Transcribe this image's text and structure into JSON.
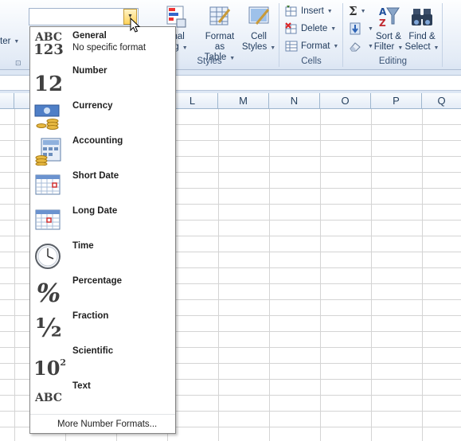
{
  "ribbon": {
    "styles": {
      "conditional_label_1": "onal",
      "conditional_label_2": "ting",
      "format_table_label_1": "Format",
      "format_table_label_2": "as Table",
      "cell_styles_label_1": "Cell",
      "cell_styles_label_2": "Styles",
      "group_label": "Styles"
    },
    "left_partial_label": "ter",
    "cells": {
      "insert": "Insert",
      "delete": "Delete",
      "format": "Format",
      "group_label": "Cells"
    },
    "editing": {
      "sort_label_1": "Sort &",
      "sort_label_2": "Filter",
      "find_label_1": "Find &",
      "find_label_2": "Select",
      "group_label": "Editing"
    }
  },
  "number_format_combo": {
    "value": ""
  },
  "columns": [
    "L",
    "M",
    "N",
    "O",
    "P",
    "Q"
  ],
  "dropdown": {
    "items": [
      {
        "title": "General",
        "subtitle": "No specific format",
        "icon": "abc-123-icon"
      },
      {
        "title": "Number",
        "subtitle": "",
        "icon": "number-12-icon"
      },
      {
        "title": "Currency",
        "subtitle": "",
        "icon": "currency-icon"
      },
      {
        "title": "Accounting",
        "subtitle": "",
        "icon": "accounting-icon"
      },
      {
        "title": "Short Date",
        "subtitle": "",
        "icon": "short-date-calendar-icon"
      },
      {
        "title": "Long Date",
        "subtitle": "",
        "icon": "long-date-calendar-icon"
      },
      {
        "title": "Time",
        "subtitle": "",
        "icon": "clock-icon"
      },
      {
        "title": "Percentage",
        "subtitle": "",
        "icon": "percent-icon"
      },
      {
        "title": "Fraction",
        "subtitle": "",
        "icon": "fraction-icon"
      },
      {
        "title": "Scientific",
        "subtitle": "",
        "icon": "scientific-icon"
      },
      {
        "title": "Text",
        "subtitle": "",
        "icon": "text-abc-icon"
      }
    ],
    "more": "More Number Formats...",
    "icon_text": {
      "general_top": "ABC",
      "general_bottom": "123",
      "number": "12",
      "percent": "%",
      "fraction": "½",
      "sci_base": "10",
      "sci_exp": "2",
      "text": "ABC"
    }
  }
}
